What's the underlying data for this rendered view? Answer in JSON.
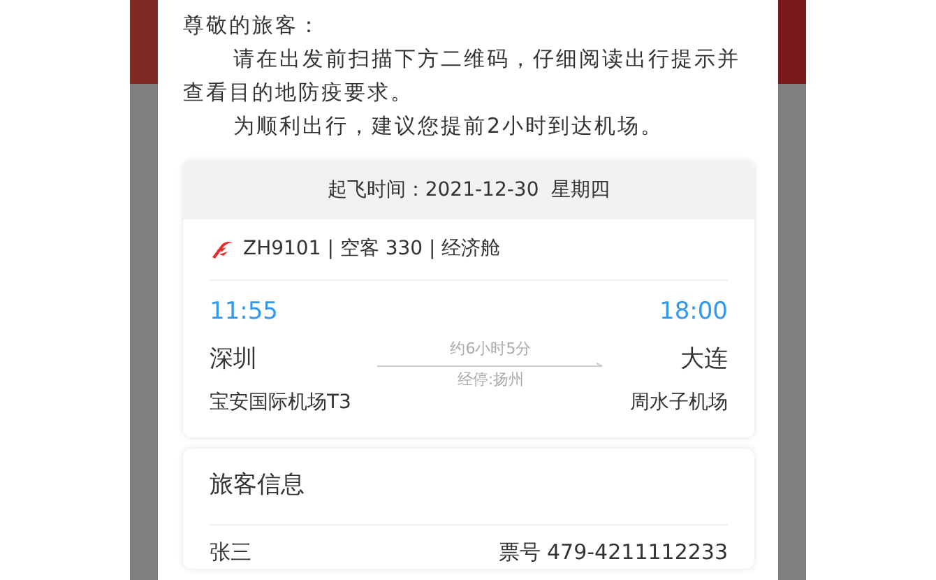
{
  "notice": {
    "salutation": "尊敬的旅客：",
    "paragraphs": [
      "请在出发前扫描下方二维码，仔细阅读出行提示并查看目的地防疫要求。",
      "为顺利出行，建议您提前2小时到达机场。"
    ]
  },
  "flight": {
    "departure_label": "起飞时间：2021-12-30  星期四",
    "summary": "ZH9101 | 空客 330 | 经济舱",
    "depart": {
      "time": "11:55",
      "city": "深圳",
      "airport": "宝安国际机场T3"
    },
    "arrive": {
      "time": "18:00",
      "city": "大连",
      "airport": "周水子机场"
    },
    "duration": "约6小时5分",
    "stopover": "经停:扬州"
  },
  "passengers": {
    "title": "旅客信息",
    "rows": [
      {
        "name": "张三",
        "ticket": "票号 479-4211112233"
      }
    ]
  }
}
